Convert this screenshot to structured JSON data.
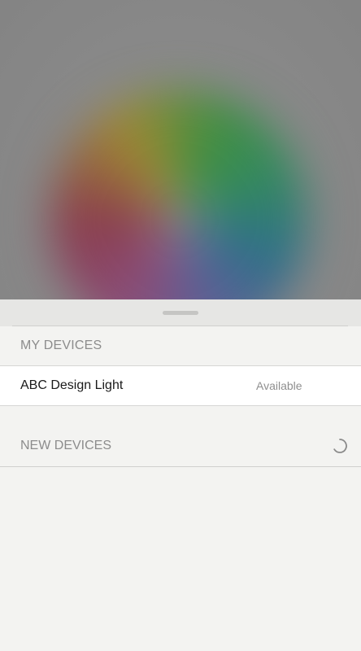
{
  "color_picker": {
    "icon": "color-wheel-blurred"
  },
  "sheet": {
    "handle_icon": "drag-handle",
    "my_devices": {
      "title": "MY DEVICES",
      "items": [
        {
          "name": "ABC Design Light",
          "status": "Available"
        }
      ]
    },
    "new_devices": {
      "title": "NEW DEVICES",
      "loading_icon": "spinner-icon"
    }
  }
}
